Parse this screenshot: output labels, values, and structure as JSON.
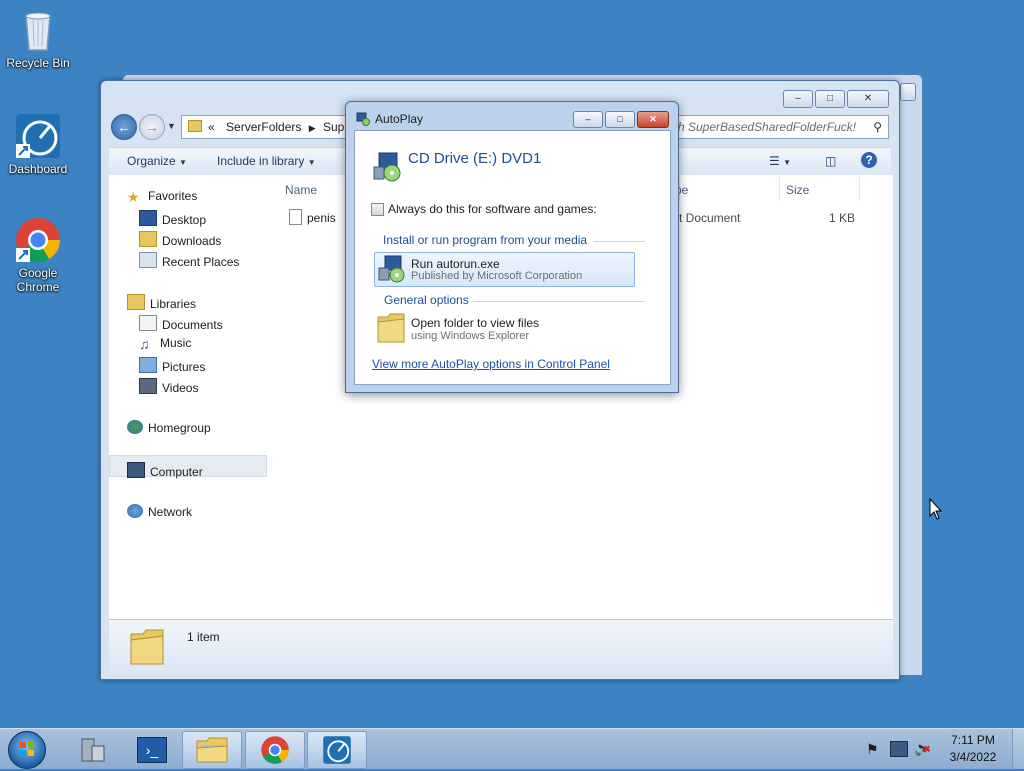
{
  "desktop": {
    "icons": [
      {
        "label": "Recycle Bin"
      },
      {
        "label": "Dashboard"
      },
      {
        "label": "Google Chrome"
      }
    ]
  },
  "explorer": {
    "breadcrumb": {
      "chevrons": "«",
      "crumb1": "ServerFolders",
      "crumb2": "SuperB"
    },
    "search_placeholder": "rch SuperBasedSharedFolderFuck!",
    "toolbar": {
      "organize": "Organize",
      "include_library": "Include in library"
    },
    "nav": {
      "favorites": "Favorites",
      "desktop": "Desktop",
      "downloads": "Downloads",
      "recent_places": "Recent Places",
      "libraries": "Libraries",
      "documents": "Documents",
      "music": "Music",
      "pictures": "Pictures",
      "videos": "Videos",
      "homegroup": "Homegroup",
      "computer": "Computer",
      "network": "Network"
    },
    "columns": {
      "name": "Name",
      "type": "pe",
      "size": "Size"
    },
    "file": {
      "name": "penis",
      "type": "xt Document",
      "size": "1 KB"
    },
    "status": {
      "count": "1 item"
    }
  },
  "autoplay": {
    "title": "AutoPlay",
    "drive": "CD Drive (E:) DVD1",
    "always_do": "Always do this for software and games:",
    "section_install": "Install or run program from your media",
    "run_title": "Run autorun.exe",
    "run_sub": "Published by Microsoft Corporation",
    "section_general": "General options",
    "open_title": "Open folder to view files",
    "open_sub": "using Windows Explorer",
    "more_link": "View more AutoPlay options in Control Panel"
  },
  "taskbar": {
    "time": "7:11 PM",
    "date": "3/4/2022"
  }
}
